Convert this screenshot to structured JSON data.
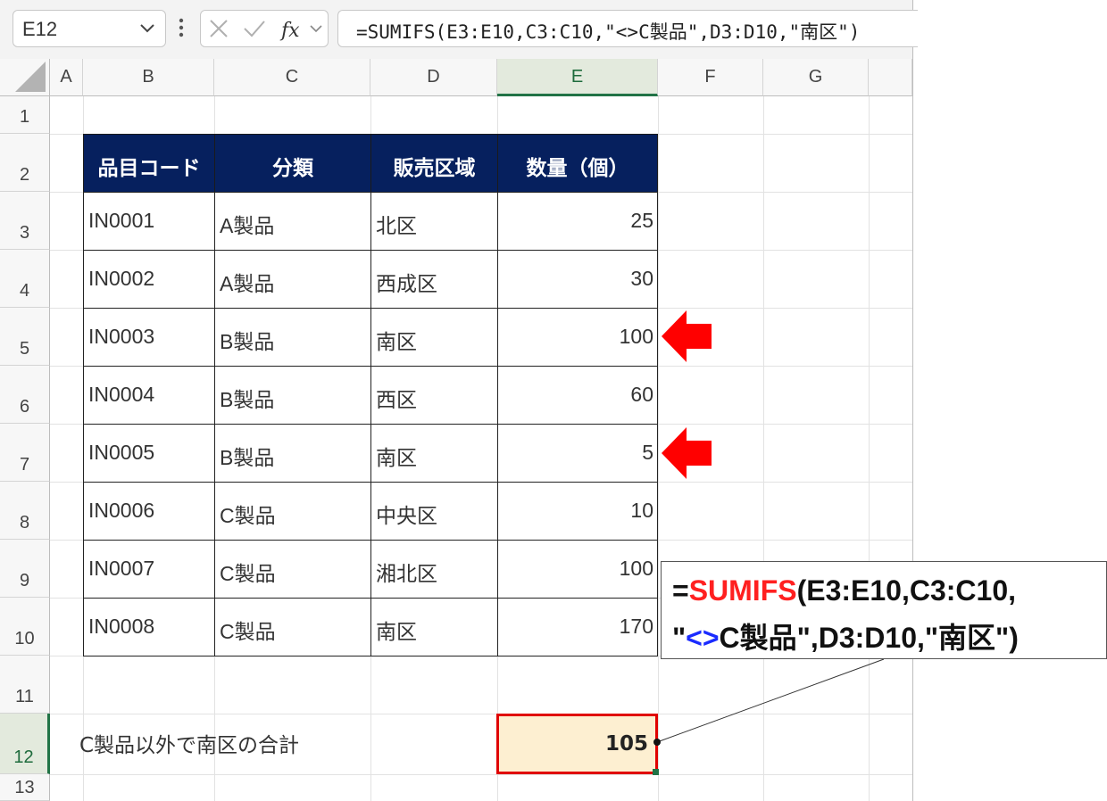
{
  "formula_bar": {
    "name_box": "E12",
    "formula": "=SUMIFS(E3:E10,C3:C10,\"<>C製品\",D3:D10,\"南区\")"
  },
  "columns": [
    "A",
    "B",
    "C",
    "D",
    "E",
    "F",
    "G"
  ],
  "selected_column": "E",
  "rows": [
    "1",
    "2",
    "3",
    "4",
    "5",
    "6",
    "7",
    "8",
    "9",
    "10",
    "11",
    "12",
    "13"
  ],
  "selected_row": "12",
  "table": {
    "headers": [
      "品目コード",
      "分類",
      "販売区域",
      "数量（個）"
    ],
    "rows": [
      [
        "IN0001",
        "A製品",
        "北区",
        "25"
      ],
      [
        "IN0002",
        "A製品",
        "西成区",
        "30"
      ],
      [
        "IN0003",
        "B製品",
        "南区",
        "100"
      ],
      [
        "IN0004",
        "B製品",
        "西区",
        "60"
      ],
      [
        "IN0005",
        "B製品",
        "南区",
        "5"
      ],
      [
        "IN0006",
        "C製品",
        "中央区",
        "10"
      ],
      [
        "IN0007",
        "C製品",
        "湘北区",
        "100"
      ],
      [
        "IN0008",
        "C製品",
        "南区",
        "170"
      ]
    ],
    "header_color": "#06205e"
  },
  "summary": {
    "label": "C製品以外で南区の合計",
    "value": "105",
    "fill_color": "#fdefd1",
    "border_color": "#e00000"
  },
  "callout": {
    "eq": "=",
    "func": "SUMIFS",
    "args1": "(E3:E10,C3:C10,",
    "quote_open": "\"",
    "op": "<>",
    "args2": "C製品\",D3:D10,\"南区\")",
    "func_color": "#ff2020",
    "op_color": "#1a2bff"
  },
  "arrows": {
    "rows": [
      "5",
      "7"
    ],
    "color": "#ff0000"
  }
}
